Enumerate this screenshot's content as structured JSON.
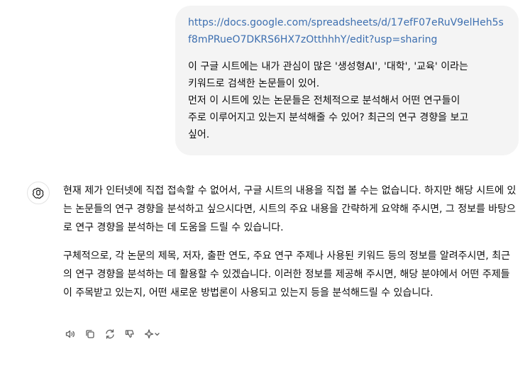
{
  "user_message": {
    "link": "https://docs.google.com/spreadsheets/d/17efF07eRuV9elHeh5sf8mPRueO7DKRS6HX7zOtthhhY/edit?usp=sharing",
    "lines": [
      "이 구글 시트에는 내가 관심이 많은 '생성형AI', '대학', '교육' 이라는",
      "키워드로 검색한 논문들이 있어.",
      "먼저 이 시트에 있는 논문들은 전체적으로 분석해서 어떤 연구들이",
      "주로 이루어지고 있는지 분석해줄 수 있어? 최근의 연구 경향을 보고",
      "싶어."
    ]
  },
  "assistant_message": {
    "icon": "openai-logo-icon",
    "paragraphs": [
      "현재 제가 인터넷에 직접 접속할 수 없어서, 구글 시트의 내용을 직접 볼 수는 없습니다. 하지만 해당 시트에 있는 논문들의 연구 경향을 분석하고 싶으시다면, 시트의 주요 내용을 간략하게 요약해 주시면, 그 정보를 바탕으로 연구 경향을 분석하는 데 도움을 드릴 수 있습니다.",
      "구체적으로, 각 논문의 제목, 저자, 출판 연도, 주요 연구 주제나 사용된 키워드 등의 정보를 알려주시면, 최근의 연구 경향을 분석하는 데 활용할 수 있겠습니다. 이러한 정보를 제공해 주시면, 해당 분야에서 어떤 주제들이 주목받고 있는지, 어떤 새로운 방법론이 사용되고 있는지 등을 분석해드릴 수 있습니다."
    ]
  },
  "actions": [
    "speaker-icon",
    "copy-icon",
    "regenerate-icon",
    "thumbs-down-icon",
    "sparkle-model-icon"
  ]
}
